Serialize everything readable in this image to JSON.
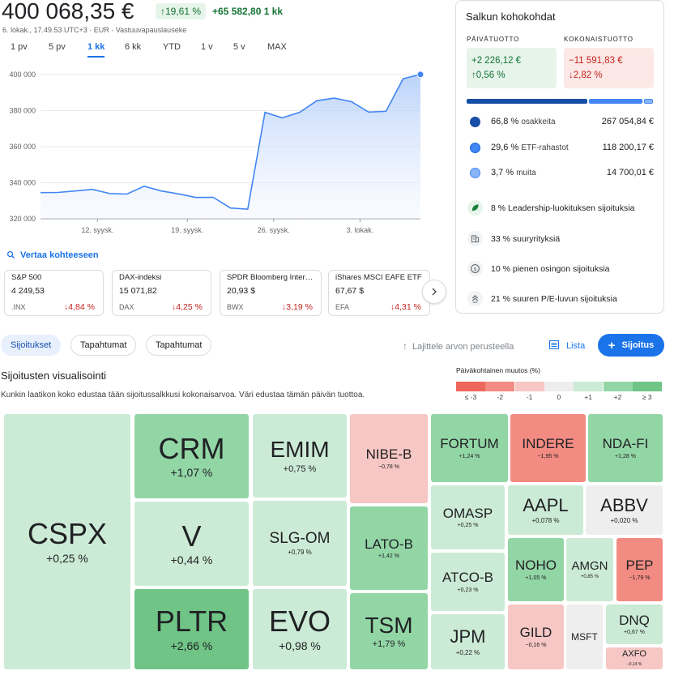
{
  "header": {
    "value": "400 068,35 €",
    "pct_change": "19,61 %",
    "abs_change": "+65 582,80 1 kk",
    "subline": "6. lokak., 17.49.53 UTC+3 · EUR · Vastuuvapauslauseke"
  },
  "ranges": [
    "1 pv",
    "5 pv",
    "1 kk",
    "6 kk",
    "YTD",
    "1 v",
    "5 v",
    "MAX"
  ],
  "active_range": "1 kk",
  "chart_data": {
    "type": "area",
    "x_ticks": [
      "12. syysk.",
      "19. syysk.",
      "26. syysk.",
      "3. lokak."
    ],
    "y_ticks": [
      "400 000",
      "380 000",
      "360 000",
      "340 000",
      "320 000"
    ],
    "ylim": [
      320000,
      400000
    ],
    "values": [
      334500,
      334600,
      335400,
      336300,
      334000,
      333700,
      338000,
      335400,
      333800,
      331800,
      331900,
      326000,
      325300,
      379000,
      376000,
      379000,
      385500,
      386900,
      385000,
      379200,
      379600,
      397700,
      400068
    ]
  },
  "compare_label": "Vertaa kohteeseen",
  "indices": [
    {
      "name": "S&P 500",
      "price": "4 249,53",
      "symbol": ".INX",
      "change": "4,84 %"
    },
    {
      "name": "DAX-indeksi",
      "price": "15 071,82",
      "symbol": "DAX",
      "change": "4,25 %"
    },
    {
      "name": "SPDR Bloomberg International Treasury",
      "price": "20,93 $",
      "symbol": "BWX",
      "change": "3,19 %"
    },
    {
      "name": "iShares MSCI EAFE ETF",
      "price": "67,67 $",
      "symbol": "EFA",
      "change": "4,31 %"
    }
  ],
  "highlights": {
    "title": "Salkun kohokohdat",
    "daily_label": "PÄIVÄTUOTTO",
    "daily_value": "+2 226,12 €",
    "daily_pct": "0,56 %",
    "total_label": "KOKONAISTUOTTO",
    "total_value": "−11 591,83 €",
    "total_pct": "2,82 %",
    "allocation": [
      {
        "pct": "66,8 %",
        "label": "osakkeita",
        "value": "267 054,84 €",
        "color": "#174ea6"
      },
      {
        "pct": "29,6 %",
        "label": "ETF-rahastot",
        "value": "118 200,17 €",
        "color": "#4285f4"
      },
      {
        "pct": "3,7 %",
        "label": "muita",
        "value": "14 700,01 €",
        "color": "#8ab4f8"
      }
    ],
    "insights": [
      {
        "text": "8 % Leadership-luokituksen sijoituksia"
      },
      {
        "text": "33 % suuryrityksiä"
      },
      {
        "text": "10 % pienen osingon sijoituksia"
      },
      {
        "text": "21 % suuren P/E-luvun sijoituksia"
      }
    ]
  },
  "tabs": [
    "Sijoitukset",
    "Tapahtumat",
    "Tapahtumat"
  ],
  "sort_label": "Lajittele arvon perusteella",
  "list_label": "Lista",
  "add_label": "Sijoitus",
  "visualization": {
    "title": "Sijoitusten visualisointi",
    "description": "Kunkin laatikon koko edustaa tään sijoitussalkkusi kokonaisarvoa. Väri edustaa tämän päivän tuottoa."
  },
  "legend": {
    "title": "Päiväkohtainen muutos (%)",
    "labels": [
      "≤ -3",
      "-2",
      "-1",
      "0",
      "+1",
      "+2",
      "≥ 3"
    ],
    "colors": [
      "#ee675c",
      "#f28b82",
      "#f6c7c4",
      "#eeeeee",
      "#ccebd6",
      "#93d6a6",
      "#6fc486"
    ]
  },
  "treemap": [
    {
      "symbol": "CSPX",
      "change": "+0,25 %"
    },
    {
      "symbol": "CRM",
      "change": "+1,07 %"
    },
    {
      "symbol": "V",
      "change": "+0,44 %"
    },
    {
      "symbol": "PLTR",
      "change": "+2,66 %"
    },
    {
      "symbol": "EMIM",
      "change": "+0,75 %"
    },
    {
      "symbol": "SLG-OM",
      "change": "+0,79 %"
    },
    {
      "symbol": "EVO",
      "change": "+0,98 %"
    },
    {
      "symbol": "NIBE-B",
      "change": "−0,78 %"
    },
    {
      "symbol": "LATO-B",
      "change": "+1,42 %"
    },
    {
      "symbol": "TSM",
      "change": "+1,79 %"
    },
    {
      "symbol": "FORTUM",
      "change": "+1,24 %"
    },
    {
      "symbol": "INDERE",
      "change": "−1,95 %"
    },
    {
      "symbol": "NDA-FI",
      "change": "+1,28 %"
    },
    {
      "symbol": "OMASP",
      "change": "+0,25 %"
    },
    {
      "symbol": "AAPL",
      "change": "+0,078 %"
    },
    {
      "symbol": "ABBV",
      "change": "+0,020 %"
    },
    {
      "symbol": "ATCO-B",
      "change": "+0,23 %"
    },
    {
      "symbol": "NOHO",
      "change": "+1,05 %"
    },
    {
      "symbol": "AMGN",
      "change": "+0,85 %"
    },
    {
      "symbol": "PEP",
      "change": "−1,79 %"
    },
    {
      "symbol": "JPM",
      "change": "+0,22 %"
    },
    {
      "symbol": "GILD",
      "change": "−0,16 %"
    },
    {
      "symbol": "MSFT",
      "change": ""
    },
    {
      "symbol": "DNQ",
      "change": "+0,67 %"
    },
    {
      "symbol": "AXFO",
      "change": "−0,14 %"
    }
  ]
}
